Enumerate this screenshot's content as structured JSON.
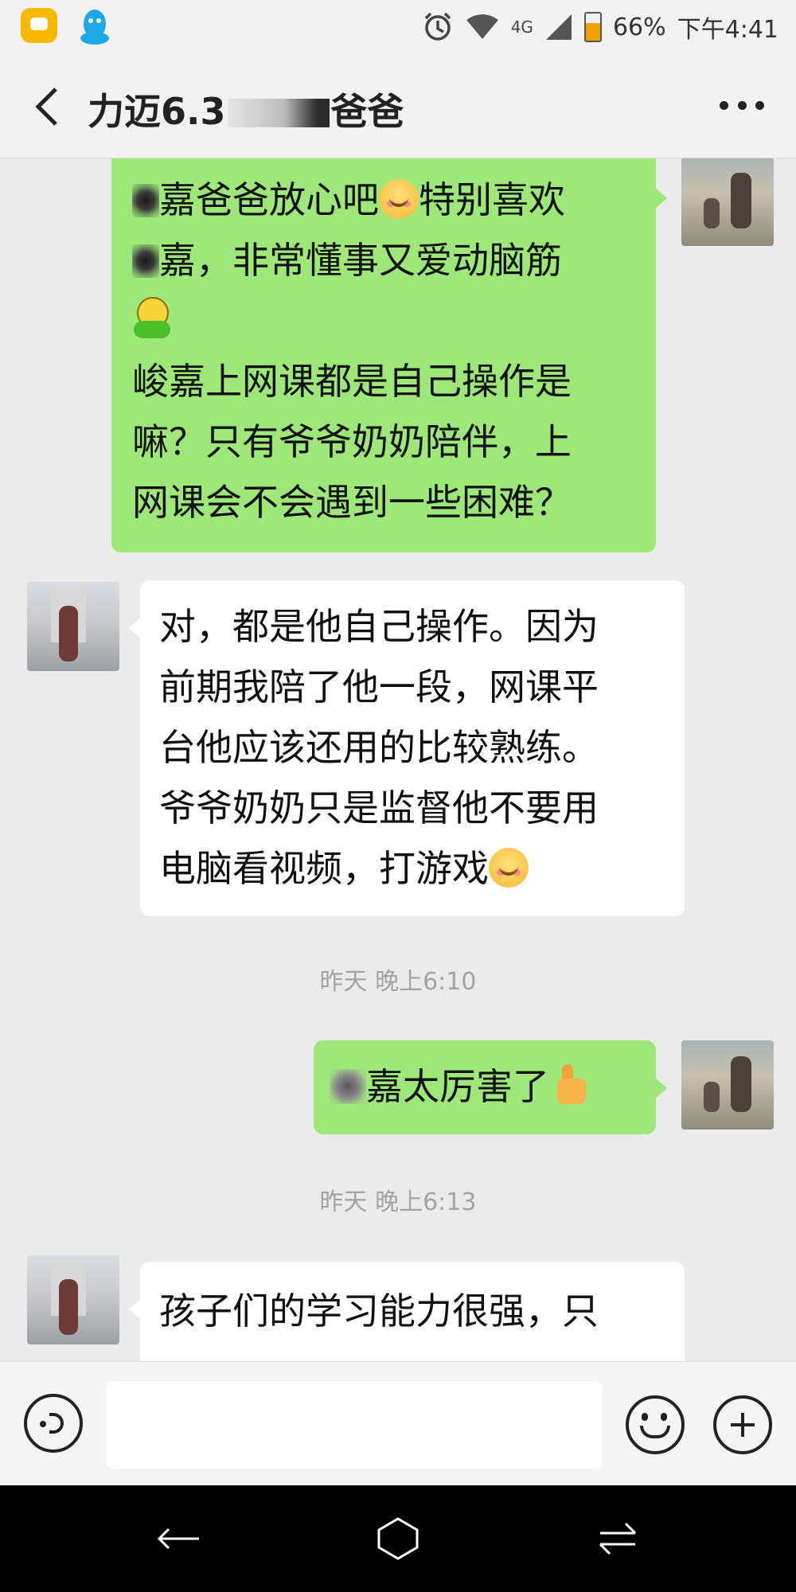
{
  "status_bar": {
    "network": "4G",
    "battery": "66%",
    "time": "下午4:41",
    "icons": [
      "message-app-icon",
      "qq-icon",
      "alarm-icon",
      "wifi-icon",
      "signal-icon",
      "battery-icon"
    ]
  },
  "title_bar": {
    "title_prefix": "力迈6.3",
    "title_suffix": "爸爸"
  },
  "messages": [
    {
      "sender": "me",
      "text_1": "嘉爸爸放心吧",
      "text_2": "特别喜欢",
      "text_3": "嘉，非常懂事又爱动脑筋",
      "text_4": "峻嘉上网课都是自己操作是\n嘛？只有爷爷奶奶陪伴，上\n网课会不会遇到一些困难？"
    },
    {
      "sender": "other",
      "text": "对，都是他自己操作。因为\n前期我陪了他一段，网课平\n台他应该还用的比较熟练。\n爷爷奶奶只是监督他不要用\n电脑看视频，打游戏"
    },
    {
      "sender": "me",
      "text": "嘉太厉害了"
    },
    {
      "sender": "other",
      "text": "孩子们的学习能力很强，只"
    }
  ],
  "timestamps": [
    "昨天 晚上6:10",
    "昨天 晚上6:13"
  ],
  "input_bar": {
    "value": "",
    "placeholder": ""
  },
  "colors": {
    "my_bubble": "#9ee87a",
    "other_bubble": "#ffffff",
    "background": "#ebebeb"
  }
}
